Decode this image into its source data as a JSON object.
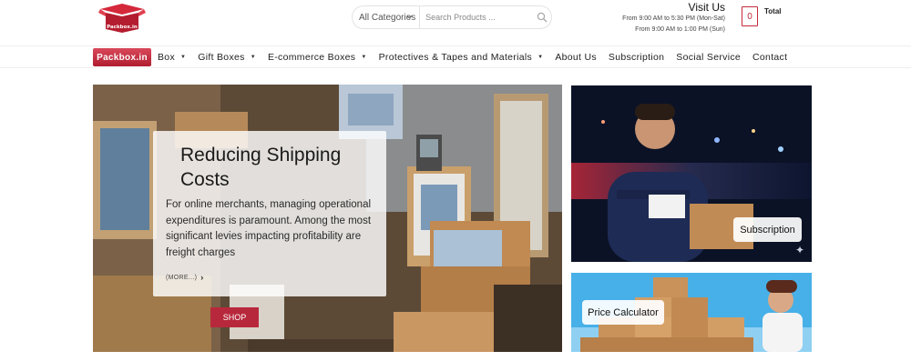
{
  "header": {
    "logo_text": "Packbox.in",
    "category_select": "All Categories",
    "search_placeholder": "Search Products ...",
    "visit": {
      "title": "Visit Us",
      "line1": "From 9:00 AM to 5:30 PM (Mon-Sat)",
      "line2": "From 9:00 AM to 1:00 PM (Sun)"
    },
    "cart_count": "0",
    "cart_label": "Total"
  },
  "nav": {
    "brand": "Packbox.in",
    "items": [
      {
        "label": "Box",
        "dropdown": true
      },
      {
        "label": "Gift Boxes",
        "dropdown": true
      },
      {
        "label": "E-commerce Boxes",
        "dropdown": true
      },
      {
        "label": "Protectives & Tapes and Materials",
        "dropdown": true
      },
      {
        "label": "About Us",
        "dropdown": false
      },
      {
        "label": "Subscription",
        "dropdown": false
      },
      {
        "label": "Social Service",
        "dropdown": false
      },
      {
        "label": "Contact",
        "dropdown": false
      }
    ]
  },
  "hero": {
    "title": "Reducing Shipping Costs",
    "text": "For online merchants, managing operational expenditures is paramount. Among the most significant levies impacting profitability are freight charges",
    "more": "(MORE...)",
    "shop": "SHOP"
  },
  "side": {
    "subscription": "Subscription",
    "price_calculator": "Price Calculator"
  },
  "colors": {
    "brand_red": "#b8283c",
    "sky_blue": "#3aa9e4"
  }
}
